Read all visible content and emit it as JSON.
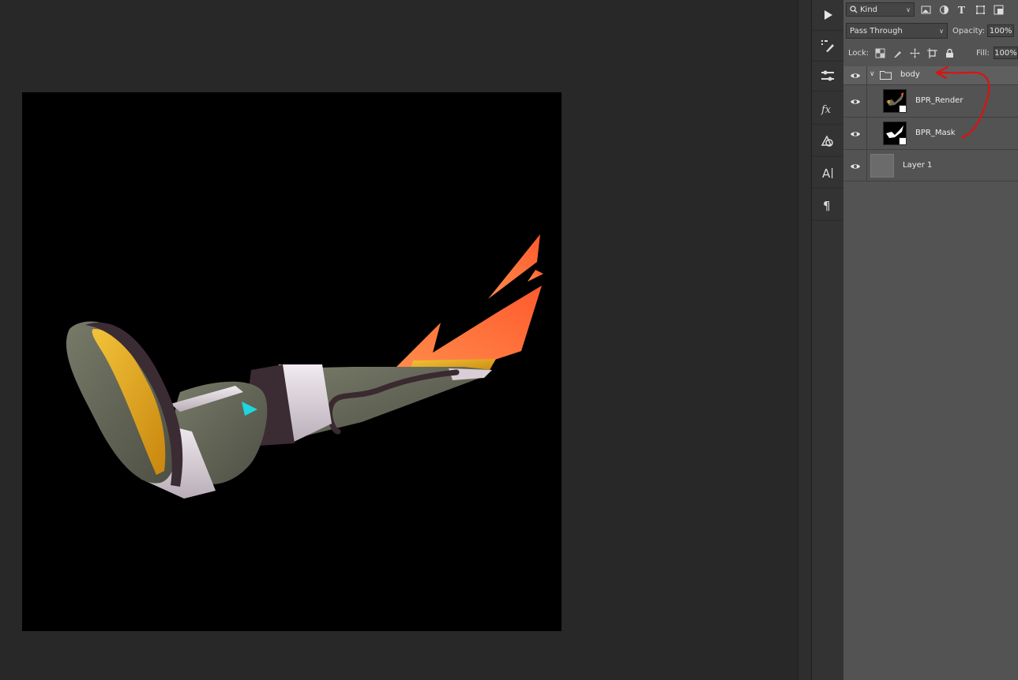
{
  "layers_panel": {
    "filter_kind": "Kind",
    "blend_mode": "Pass Through",
    "opacity_label": "Opacity:",
    "opacity_value": "100%",
    "lock_label": "Lock:",
    "fill_label": "Fill:",
    "fill_value": "100%",
    "layers": [
      {
        "name": "body",
        "type": "group",
        "visible": true,
        "expanded": true
      },
      {
        "name": "BPR_Render",
        "type": "smart-object",
        "visible": true
      },
      {
        "name": "BPR_Mask",
        "type": "smart-object",
        "visible": true
      },
      {
        "name": "Layer 1",
        "type": "raster",
        "visible": true
      }
    ]
  },
  "toolstrip": [
    "play-icon",
    "brush-presets-icon",
    "adjustments-icon",
    "fx-icon",
    "clone-source-icon",
    "character-icon",
    "paragraph-icon"
  ],
  "annotation": {
    "type": "red-arrow",
    "color": "#e01010",
    "from": "BPR_Mask",
    "to": "body"
  },
  "colors": {
    "workspace": "#282828",
    "panel": "#535353",
    "canvas": "#000000",
    "accent_orange": "#ff6b3a",
    "accent_cyan": "#1fd5e0",
    "accent_gold": "#e0a516"
  }
}
